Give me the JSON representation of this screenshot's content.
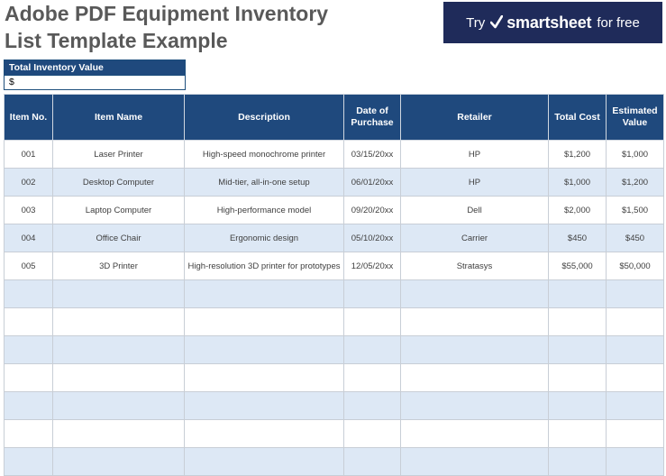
{
  "title": {
    "line1": "Adobe PDF Equipment Inventory",
    "line2": "List Template Example"
  },
  "banner": {
    "try": "Try",
    "brand": "smartsheet",
    "suffix": "for free",
    "background": "#1f2b5a"
  },
  "total_inventory": {
    "label": "Total Inventory Value",
    "value": "$"
  },
  "table": {
    "header_color": "#1f497d",
    "stripe_color": "#dde8f5",
    "columns": [
      "Item No.",
      "Item Name",
      "Description",
      "Date of Purchase",
      "Retailer",
      "Total Cost",
      "Estimated Value"
    ],
    "rows": [
      [
        "001",
        "Laser Printer",
        "High-speed monochrome printer",
        "03/15/20xx",
        "HP",
        "$1,200",
        "$1,000"
      ],
      [
        "002",
        "Desktop Computer",
        "Mid-tier, all-in-one setup",
        "06/01/20xx",
        "HP",
        "$1,000",
        "$1,200"
      ],
      [
        "003",
        "Laptop Computer",
        "High-performance model",
        "09/20/20xx",
        "Dell",
        "$2,000",
        "$1,500"
      ],
      [
        "004",
        "Office Chair",
        "Ergonomic design",
        "05/10/20xx",
        "Carrier",
        "$450",
        "$450"
      ],
      [
        "005",
        "3D Printer",
        "High-resolution 3D printer for prototypes",
        "12/05/20xx",
        "Stratasys",
        "$55,000",
        "$50,000"
      ],
      [
        "",
        "",
        "",
        "",
        "",
        "",
        ""
      ],
      [
        "",
        "",
        "",
        "",
        "",
        "",
        ""
      ],
      [
        "",
        "",
        "",
        "",
        "",
        "",
        ""
      ],
      [
        "",
        "",
        "",
        "",
        "",
        "",
        ""
      ],
      [
        "",
        "",
        "",
        "",
        "",
        "",
        ""
      ],
      [
        "",
        "",
        "",
        "",
        "",
        "",
        ""
      ],
      [
        "",
        "",
        "",
        "",
        "",
        "",
        ""
      ]
    ]
  }
}
